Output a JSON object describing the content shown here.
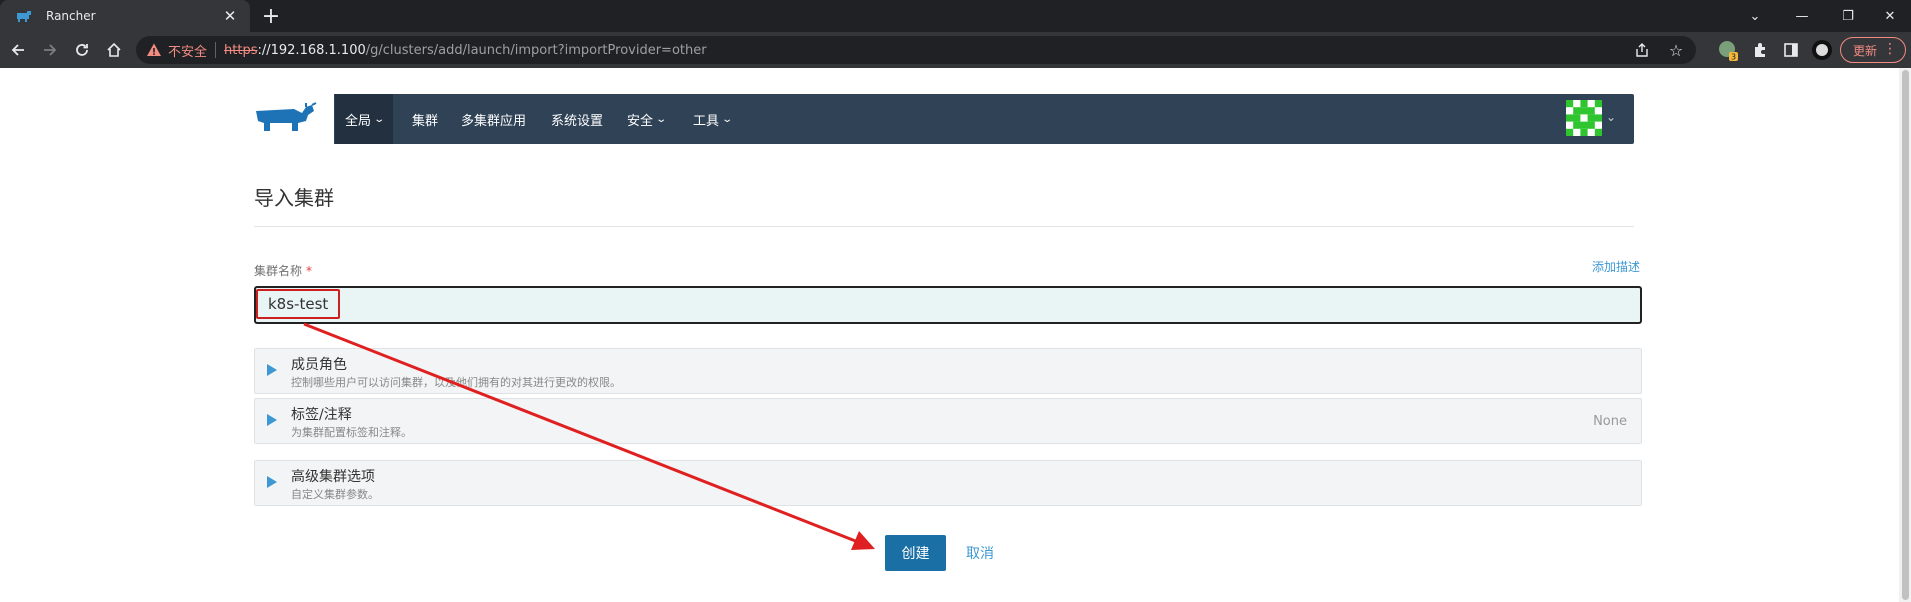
{
  "browser": {
    "tab_title": "Rancher",
    "insecure_label": "不安全",
    "url_scheme": "https",
    "url_host": "://192.168.1.100",
    "url_path": "/g/clusters/add/launch/import?importProvider=other",
    "update_label": "更新",
    "extension_badge": "3"
  },
  "navbar": {
    "items": [
      {
        "label": "全局",
        "has_caret": true
      },
      {
        "label": "集群"
      },
      {
        "label": "多集群应用"
      },
      {
        "label": "系统设置"
      },
      {
        "label": "安全",
        "has_caret": true
      },
      {
        "label": "工具",
        "has_caret": true
      }
    ]
  },
  "page": {
    "title": "导入集群",
    "cluster_name_label": "集群名称",
    "required_mark": "*",
    "add_description": "添加描述",
    "cluster_name_value": "k8s-test"
  },
  "sections": [
    {
      "title": "成员角色",
      "subtitle": "控制哪些用户可以访问集群，以及他们拥有的对其进行更改的权限。",
      "right": ""
    },
    {
      "title": "标签/注释",
      "subtitle": "为集群配置标签和注释。",
      "right": "None"
    },
    {
      "title": "高级集群选项",
      "subtitle": "自定义集群参数。",
      "right": ""
    }
  ],
  "actions": {
    "create": "创建",
    "cancel": "取消"
  },
  "colors": {
    "navbar": "#2f4256",
    "accent": "#3d98d3",
    "primary_button": "#1a6fa5",
    "annotation": "#e02020"
  }
}
